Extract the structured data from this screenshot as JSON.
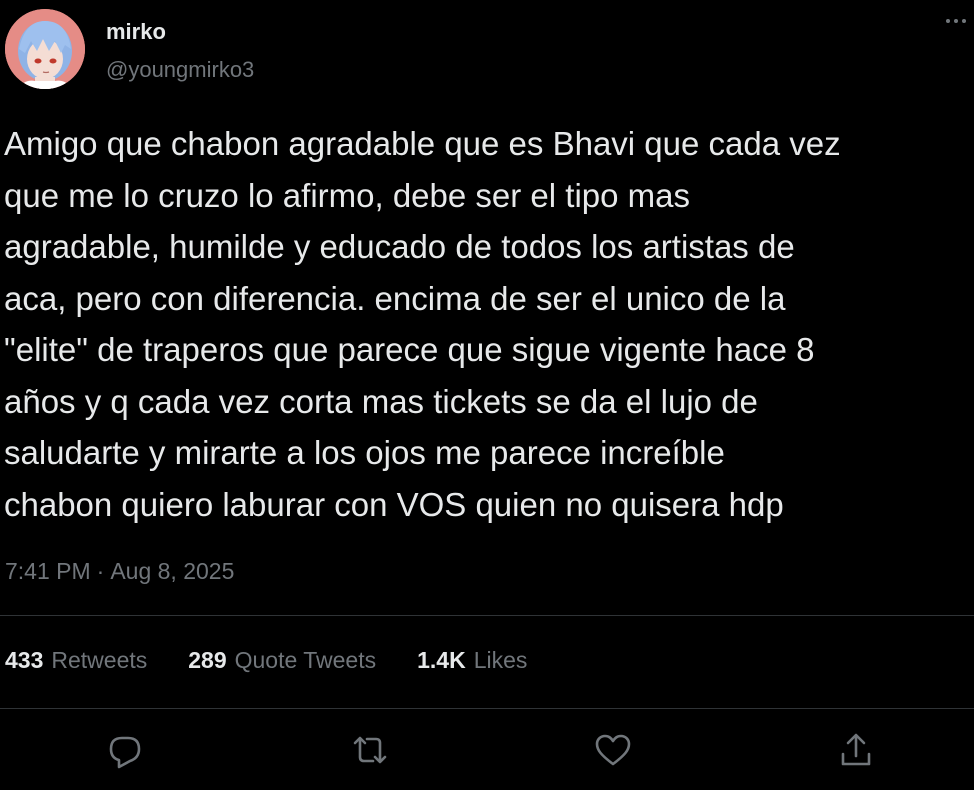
{
  "author": {
    "display_name": "mirko",
    "handle": "@youngmirko3",
    "avatar_icon": "anime-avatar"
  },
  "tweet": {
    "text_lines": [
      "Amigo que chabon agradable que es Bhavi que cada vez",
      "que me lo cruzo lo afirmo, debe ser el tipo mas",
      "agradable, humilde y educado de todos los artistas de",
      "aca, pero con diferencia. encima de ser el unico de la",
      "\"elite\" de traperos que parece que sigue vigente hace 8",
      "años y q cada vez corta mas tickets se da el lujo de",
      "saludarte y mirarte a los ojos me parece increíble",
      "chabon quiero laburar con VOS quien no quisera hdp"
    ],
    "time": "7:41 PM",
    "separator": "·",
    "date": "Aug 8, 2025"
  },
  "stats": {
    "retweets": {
      "count": "433",
      "label": "Retweets"
    },
    "quote_tweets": {
      "count": "289",
      "label": "Quote Tweets"
    },
    "likes": {
      "count": "1.4K",
      "label": "Likes"
    }
  },
  "actions": {
    "icons": [
      "reply-icon",
      "retweet-icon",
      "like-icon",
      "share-icon"
    ]
  },
  "colors": {
    "background": "#000000",
    "primary_text": "#e7e9ea",
    "secondary_text": "#71767b",
    "divider": "#2f3336"
  }
}
